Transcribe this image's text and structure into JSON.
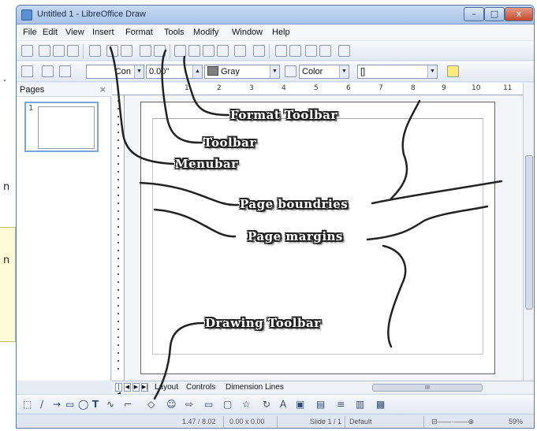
{
  "background_page": {
    "fragments": [
      ".",
      "n",
      "n"
    ]
  },
  "window": {
    "title": "Untitled 1 - LibreOffice Draw",
    "controls": {
      "minimize": "–",
      "maximize": "□",
      "close": "x"
    }
  },
  "menubar": {
    "items": [
      "File",
      "Edit",
      "View",
      "Insert",
      "Format",
      "Tools",
      "Modify",
      "Window",
      "Help"
    ]
  },
  "format_toolbar": {
    "line_style_value": "Con",
    "line_width_value": "0.00\"",
    "line_color_value": "Gray",
    "area_style_value": "Color",
    "area_fill_value": "[]"
  },
  "pages_pane": {
    "title": "Pages",
    "close": "×",
    "thumbnail_number": "1"
  },
  "ruler": {
    "ticks": [
      "1",
      "2",
      "3",
      "4",
      "5",
      "6",
      "7",
      "8",
      "9",
      "10",
      "11"
    ]
  },
  "tabs": {
    "items": [
      "Layout",
      "Controls",
      "Dimension Lines"
    ],
    "nav": [
      "|◀",
      "◀",
      "▶",
      "▶|"
    ],
    "scroll_mark": "III"
  },
  "statusbar": {
    "position": "1.47 / 8.02",
    "size": "0.00 x 0.00",
    "slide": "Slide 1 / 1",
    "master": "Default",
    "zoom": "59%"
  },
  "annotations": {
    "format_toolbar": "Format Toolbar",
    "toolbar": "Toolbar",
    "menubar": "Menubar",
    "page_boundries": "Page boundries",
    "page_margins": "Page margins",
    "drawing_toolbar": "Drawing Toolbar"
  },
  "colors": {
    "titlebar": "#a9c3e6",
    "window_bg": "#e6ecf5",
    "callout_text": "#ffffff",
    "callout_outline": "#222222"
  }
}
